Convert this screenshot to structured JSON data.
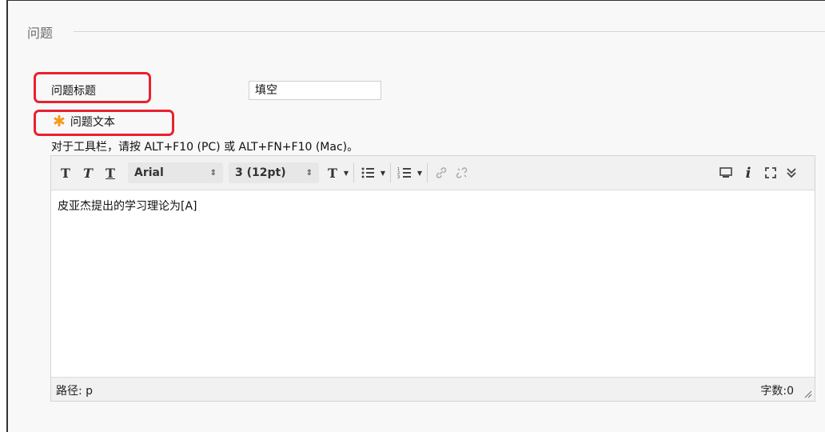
{
  "fieldset": {
    "legend": "问题"
  },
  "question_title": {
    "label": "问题标题",
    "value": "填空"
  },
  "question_text": {
    "required_mark": "✱",
    "label": "问题文本"
  },
  "hint": "对于工具栏，请按 ALT+F10 (PC) 或 ALT+FN+F10 (Mac)。",
  "toolbar": {
    "bold": "T",
    "italic": "T",
    "underline": "T",
    "font_family": "Arial",
    "font_size": "3 (12pt)",
    "text_color": "T",
    "updown": "⇕"
  },
  "editor": {
    "content": "皮亚杰提出的学习理论为[A]"
  },
  "status": {
    "path": "路径: p",
    "word_count": "字数:0"
  },
  "colors": {
    "highlight": "#e8222e",
    "required": "#f39b1d"
  }
}
